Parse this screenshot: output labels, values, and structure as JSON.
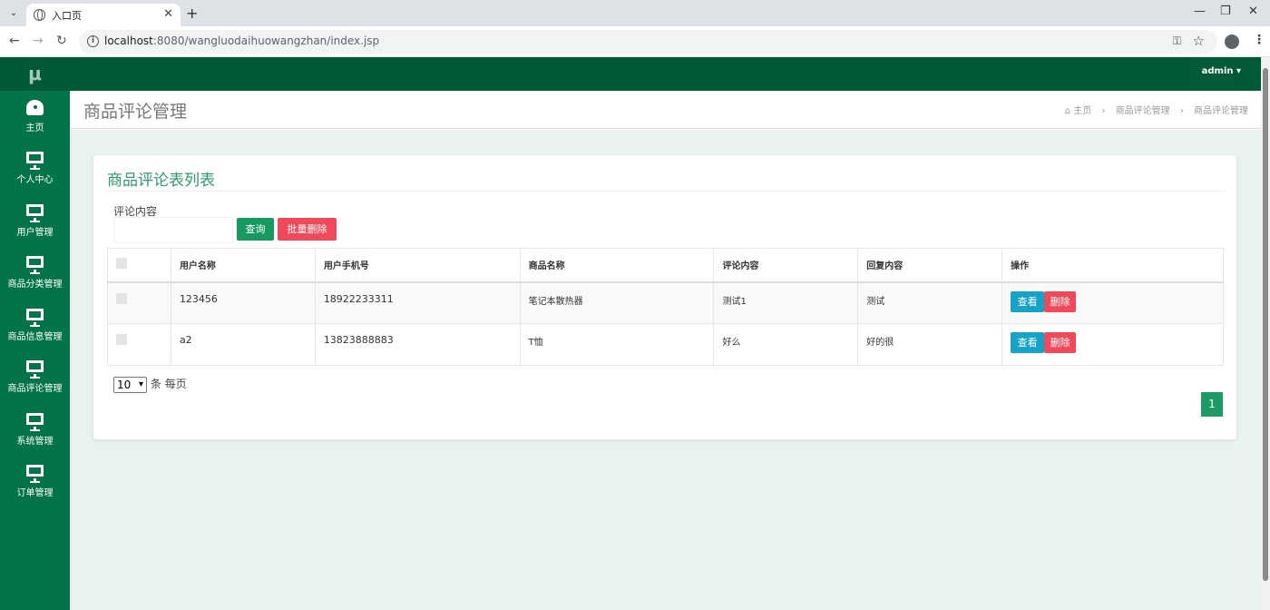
{
  "browser": {
    "tab_title": "入口页",
    "url_host": "localhost",
    "url_rest": ":8080/wangluodaihuowangzhan/index.jsp"
  },
  "app": {
    "logo": "μ",
    "user": "admin ▾",
    "sidebar": [
      {
        "label": "主页",
        "icon": "dashboard-icon"
      },
      {
        "label": "个人中心",
        "icon": "monitor-icon"
      },
      {
        "label": "用户管理",
        "icon": "monitor-icon"
      },
      {
        "label": "商品分类管理",
        "icon": "monitor-icon"
      },
      {
        "label": "商品信息管理",
        "icon": "monitor-icon"
      },
      {
        "label": "商品评论管理",
        "icon": "monitor-icon"
      },
      {
        "label": "系统管理",
        "icon": "monitor-icon"
      },
      {
        "label": "订单管理",
        "icon": "monitor-icon"
      }
    ]
  },
  "header": {
    "title": "商品评论管理",
    "breadcrumb": [
      "主页",
      "商品评论管理",
      "商品评论管理"
    ]
  },
  "card": {
    "title": "商品评论表列表",
    "filter_label": "评论内容",
    "filter_value": "",
    "query_label": "查询",
    "batch_delete_label": "批量删除"
  },
  "table": {
    "headers": [
      "用户名称",
      "用户手机号",
      "商品名称",
      "评论内容",
      "回复内容",
      "操作"
    ],
    "rows": [
      {
        "username": "123456",
        "phone": "18922233311",
        "product": "笔记本散热器",
        "comment": "测试1",
        "reply": "测试",
        "view": "查看",
        "delete": "删除"
      },
      {
        "username": "a2",
        "phone": "13823888883",
        "product": "T恤",
        "comment": "好么",
        "reply": "好的很",
        "view": "查看",
        "delete": "删除"
      }
    ]
  },
  "pagination": {
    "page_size": "10",
    "page_size_suffix": "条 每页",
    "current_page": "1"
  }
}
